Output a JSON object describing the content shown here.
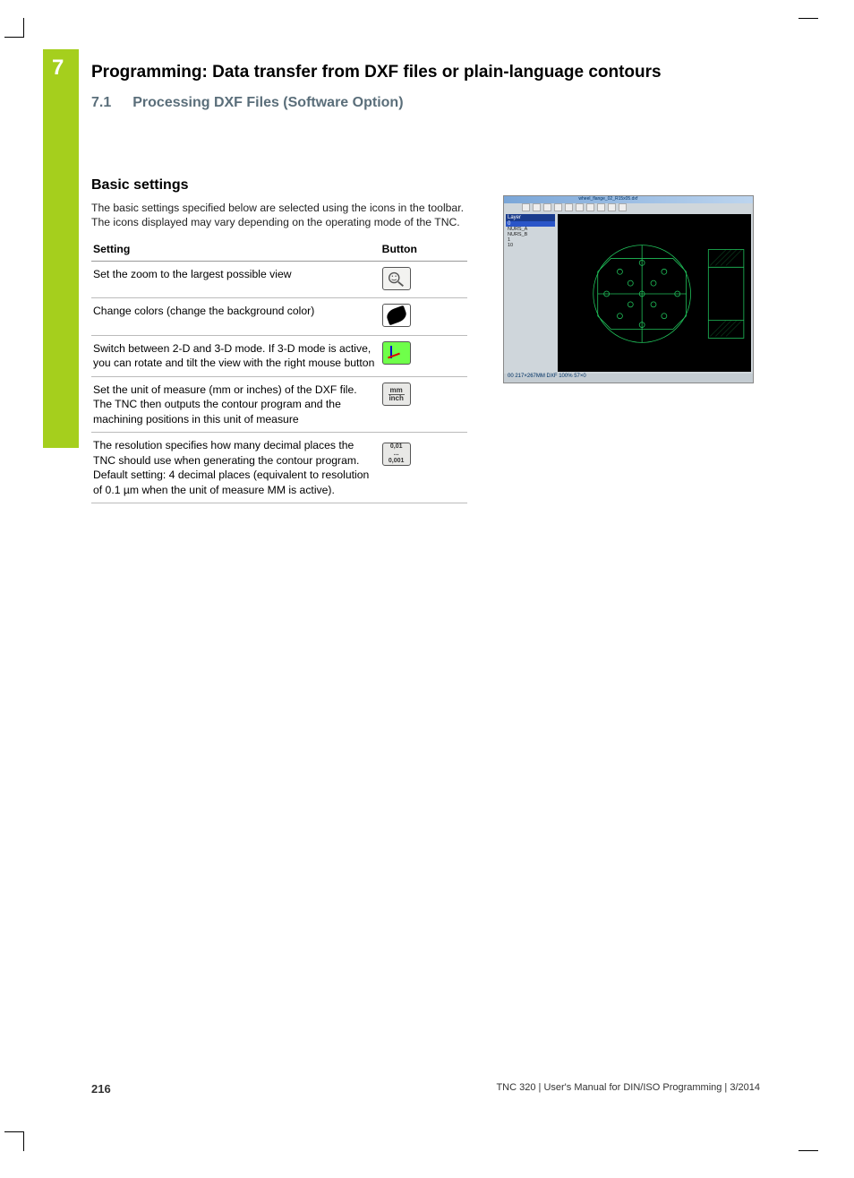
{
  "chapter": {
    "number": "7",
    "title": "Programming: Data transfer from DXF files or plain-language contours"
  },
  "section": {
    "number": "7.1",
    "title": "Processing DXF Files (Software Option)"
  },
  "basic_settings": {
    "heading": "Basic settings",
    "intro": "The basic settings specified below are selected using the icons in the toolbar. The icons displayed may vary depending on the operating mode of the TNC.",
    "columns": {
      "setting": "Setting",
      "button": "Button"
    },
    "rows": [
      {
        "desc": "Set the zoom to the largest possible view",
        "icon": "zoom"
      },
      {
        "desc": "Change colors (change the background color)",
        "icon": "colors"
      },
      {
        "desc": "Switch between 2-D and 3-D mode. If 3-D mode is active, you can rotate and tilt the view with the right mouse button",
        "icon": "3d"
      },
      {
        "desc": "Set the unit of measure (mm or inches) of the DXF file. The TNC then outputs the contour program and the machining positions in this unit of measure",
        "icon": "unit",
        "unit1": "mm",
        "unit2": "inch"
      },
      {
        "desc": "The resolution specifies how many decimal places the TNC should use when generating the contour program. Default setting: 4 decimal places (equivalent to resolution of 0.1 µm when the unit of measure MM is active).",
        "icon": "res",
        "res1": "0,01",
        "res2": "...",
        "res3": "0,001"
      }
    ]
  },
  "screenshot": {
    "title": "wheel_flange_02_R15x05.dxf",
    "sidebar_header": "Layer",
    "sidebar_selected": "0",
    "sidebar_items": [
      "NURS_A",
      "NURS_B",
      "1",
      "10"
    ],
    "status": "00   217×267MM   DXF   100%   57×0"
  },
  "footer": {
    "page": "216",
    "doc": "TNC 320 | User's Manual for DIN/ISO Programming | 3/2014"
  }
}
